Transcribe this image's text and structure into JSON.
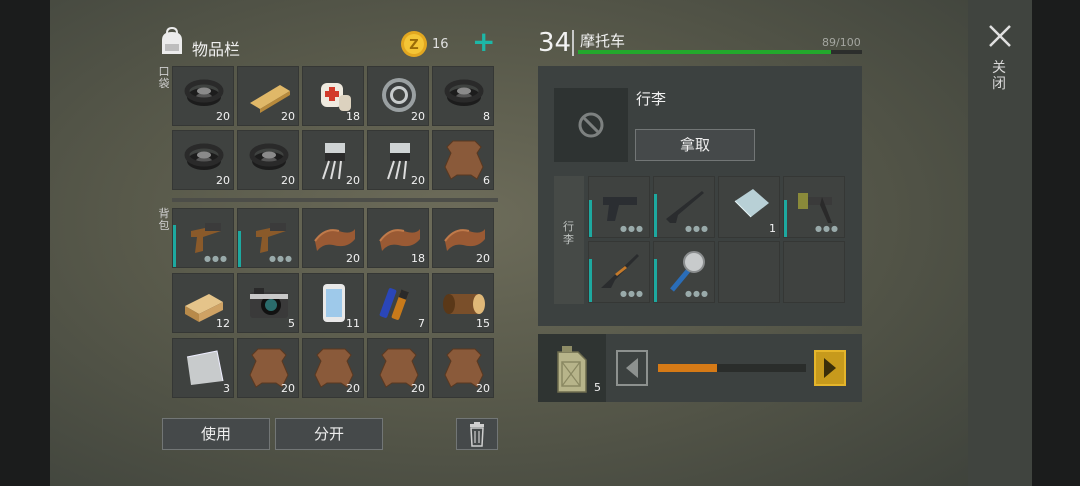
{
  "inventory": {
    "title": "物品栏",
    "coins": "16",
    "pocket_label": "口袋",
    "backpack_label": "背包",
    "use_label": "使用",
    "split_label": "分开",
    "pocket": [
      {
        "icon": "tire-icon",
        "qty": "20"
      },
      {
        "icon": "wood-plank-icon",
        "qty": "20"
      },
      {
        "icon": "bandage-icon",
        "qty": "18"
      },
      {
        "icon": "bearing-icon",
        "qty": "20"
      },
      {
        "icon": "tire-icon",
        "qty": "8"
      },
      {
        "icon": "tire-icon",
        "qty": "20"
      },
      {
        "icon": "tire-icon",
        "qty": "20"
      },
      {
        "icon": "transistor-icon",
        "qty": "20"
      },
      {
        "icon": "transistor-icon",
        "qty": "20"
      },
      {
        "icon": "hide-icon",
        "qty": "6"
      }
    ],
    "backpack": [
      {
        "icon": "flare-gun-icon",
        "qty": "",
        "durability": 0.7
      },
      {
        "icon": "flare-gun-icon",
        "qty": "",
        "durability": 0.6
      },
      {
        "icon": "leather-icon",
        "qty": "20"
      },
      {
        "icon": "leather-icon",
        "qty": "18"
      },
      {
        "icon": "leather-icon",
        "qty": "20"
      },
      {
        "icon": "wood-block-icon",
        "qty": "12"
      },
      {
        "icon": "camera-icon",
        "qty": "5"
      },
      {
        "icon": "phone-icon",
        "qty": "11"
      },
      {
        "icon": "battery-icon",
        "qty": "7"
      },
      {
        "icon": "log-icon",
        "qty": "15"
      },
      {
        "icon": "metal-plate-icon",
        "qty": "3"
      },
      {
        "icon": "hide-icon",
        "qty": "20"
      },
      {
        "icon": "hide-icon",
        "qty": "20"
      },
      {
        "icon": "hide-icon",
        "qty": "20"
      },
      {
        "icon": "hide-icon",
        "qty": "20"
      }
    ]
  },
  "vehicle": {
    "level": "34",
    "name": "摩托车",
    "hp_text": "89/100",
    "hp_fraction": 0.89,
    "trunk_title": "行李",
    "take_label": "拿取",
    "slots_label": "行李",
    "slots": [
      {
        "icon": "pistol-icon",
        "qty": "",
        "durability": 0.6
      },
      {
        "icon": "rifle-icon",
        "qty": "",
        "durability": 0.7
      },
      {
        "icon": "glass-plate-icon",
        "qty": "1"
      },
      {
        "icon": "crossbow-icon",
        "qty": "",
        "durability": 0.6
      },
      {
        "icon": "shotgun-icon",
        "qty": "",
        "durability": 0.7
      },
      {
        "icon": "saw-club-icon",
        "qty": "",
        "durability": 0.7
      },
      {
        "icon": "",
        "qty": ""
      },
      {
        "icon": "",
        "qty": ""
      }
    ],
    "fuel_qty": "5",
    "fuel_fraction": 0.4
  },
  "close_label": "关闭",
  "colors": {
    "accent": "#1cb7a7",
    "hp": "#23a82c",
    "fuel": "#d67a16"
  }
}
